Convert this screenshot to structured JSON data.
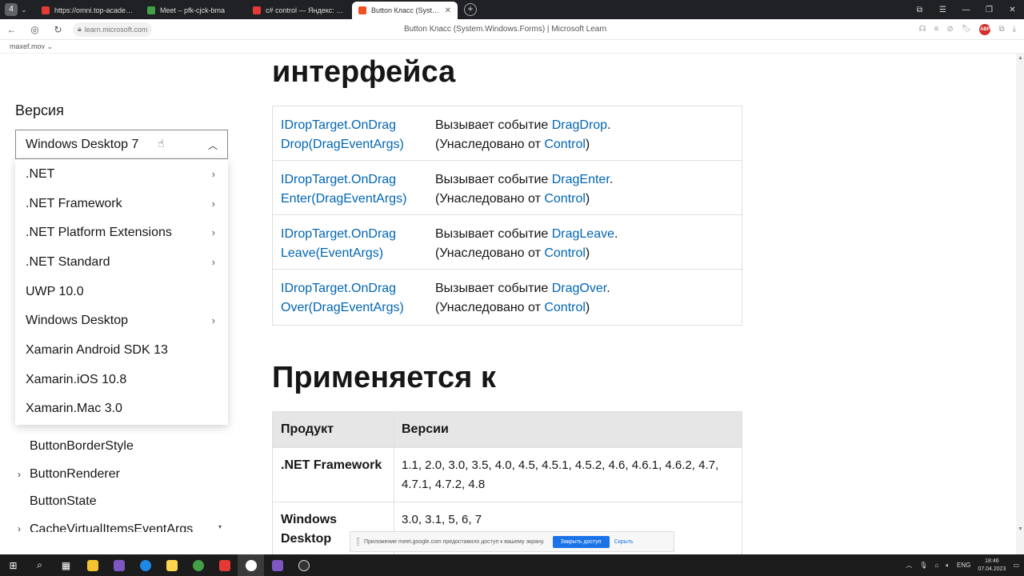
{
  "browser": {
    "tab_count": "4",
    "tabs": [
      {
        "title": "https://omni.top-academy",
        "color": "#e53935"
      },
      {
        "title": "Meet – pfk-cjck-bma",
        "color": "#43a047"
      },
      {
        "title": "c# control — Яндекс: наш",
        "color": "#e53935"
      },
      {
        "title": "Button Класс (System.W",
        "color": "#f25022"
      }
    ],
    "url": "learn.microsoft.com",
    "page_title": "Button Класс (System.Windows.Forms) | Microsoft Learn",
    "extension_badge": "ABP",
    "bookmark": "maxef.mov ⌄"
  },
  "sidebar": {
    "version_label": "Версия",
    "selected_version": "Windows Desktop 7",
    "options": [
      {
        "label": ".NET",
        "has_submenu": true
      },
      {
        "label": ".NET Framework",
        "has_submenu": true
      },
      {
        "label": ".NET Platform Extensions",
        "has_submenu": true
      },
      {
        "label": ".NET Standard",
        "has_submenu": true
      },
      {
        "label": "UWP 10.0",
        "has_submenu": false
      },
      {
        "label": "Windows Desktop",
        "has_submenu": true
      },
      {
        "label": "Xamarin Android SDK 13",
        "has_submenu": false
      },
      {
        "label": "Xamarin.iOS 10.8",
        "has_submenu": false
      },
      {
        "label": "Xamarin.Mac 3.0",
        "has_submenu": false
      }
    ],
    "tree_items": [
      {
        "label": "ButtonBorderStyle",
        "expandable": false
      },
      {
        "label": "ButtonRenderer",
        "expandable": true
      },
      {
        "label": "ButtonState",
        "expandable": false
      },
      {
        "label": "CacheVirtualItemsEventArgs",
        "expandable": true
      }
    ]
  },
  "main": {
    "heading_interface": "интерфейса",
    "events": [
      {
        "name": "IDropTarget.OnDragDrop(DragEventArgs)",
        "name_l1": "IDropTarget.OnDrag",
        "name_l2": "Drop(DragEventArgs)",
        "desc_prefix": "Вызывает событие ",
        "desc_link": "DragDrop",
        "inherited_prefix": "(Унаследовано от ",
        "inherited_link": "Control",
        "inherited_suffix": ")"
      },
      {
        "name": "IDropTarget.OnDragEnter(DragEventArgs)",
        "name_l1": "IDropTarget.OnDrag",
        "name_l2": "Enter(DragEventArgs)",
        "desc_prefix": "Вызывает событие ",
        "desc_link": "DragEnter",
        "inherited_prefix": "(Унаследовано от ",
        "inherited_link": "Control",
        "inherited_suffix": ")"
      },
      {
        "name": "IDropTarget.OnDragLeave(EventArgs)",
        "name_l1": "IDropTarget.OnDrag",
        "name_l2": "Leave(EventArgs)",
        "desc_prefix": "Вызывает событие ",
        "desc_link": "DragLeave",
        "inherited_prefix": "(Унаследовано от ",
        "inherited_link": "Control",
        "inherited_suffix": ")"
      },
      {
        "name": "IDropTarget.OnDragOver(DragEventArgs)",
        "name_l1": "IDropTarget.OnDrag",
        "name_l2": "Over(DragEventArgs)",
        "desc_prefix": "Вызывает событие ",
        "desc_link": "DragOver",
        "inherited_prefix": "(Унаследовано от ",
        "inherited_link": "Control",
        "inherited_suffix": ")"
      }
    ],
    "heading_applies": "Применяется к",
    "products_table": {
      "headers": [
        "Продукт",
        "Версии"
      ],
      "rows": [
        {
          "product": ".NET Framework",
          "versions_l1": "1.1, 2.0, 3.0, 3.5, 4.0, 4.5, 4.5.1, 4.5.2, 4.6, 4.6.1, 4.6.2, 4.7,",
          "versions_l2": "4.7.1, 4.7.2, 4.8"
        },
        {
          "product_l1": "Windows",
          "product_l2": "Desktop",
          "versions_l1": "3.0, 3.1, 5, 6, 7"
        }
      ]
    }
  },
  "share_banner": {
    "text": "Приложение meet.google.com предоставило доступ к вашему экрану.",
    "stop_button": "Закрыть доступ",
    "hide_button": "Скрыть"
  },
  "taskbar": {
    "language": "ENG",
    "time": "18:46",
    "date": "07.04.2023"
  },
  "colors": {
    "link": "#0065b3",
    "text": "#161616",
    "accent": "#1a73e8"
  }
}
